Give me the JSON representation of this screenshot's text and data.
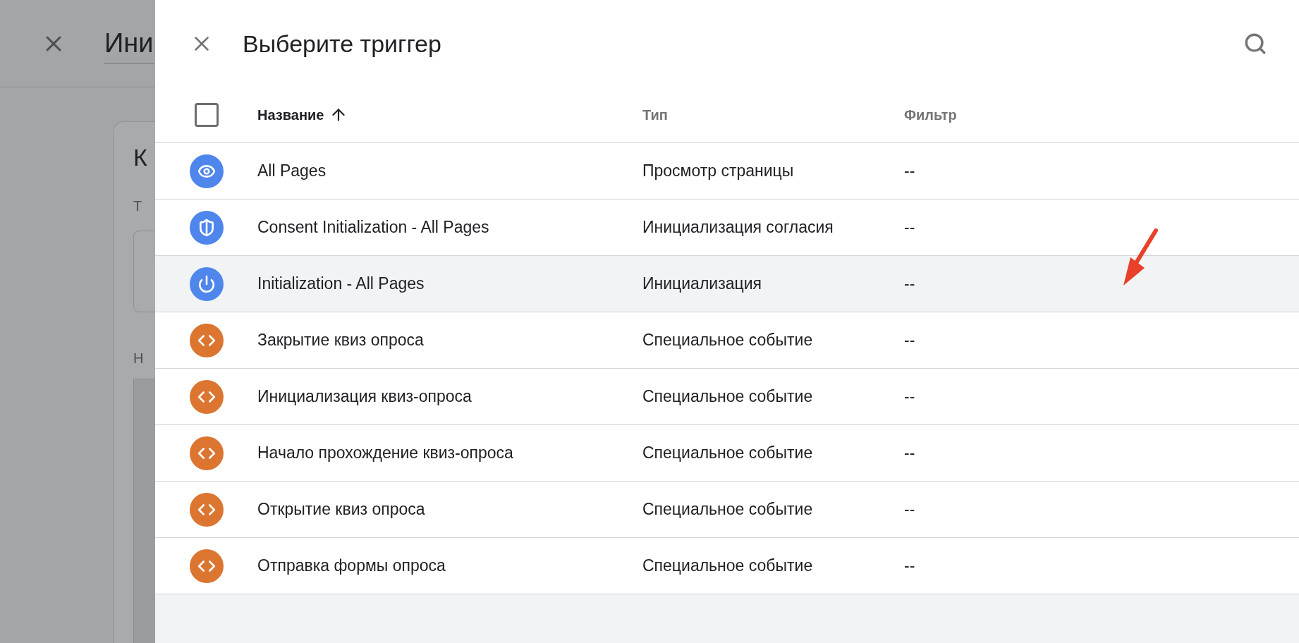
{
  "background_page": {
    "title": "Ини",
    "card_title": "К",
    "field_label": "Т",
    "section_label": "Н"
  },
  "panel": {
    "title": "Выберите триггер"
  },
  "table": {
    "select_all_checked": false,
    "columns": [
      {
        "label": "Название",
        "sorted": true
      },
      {
        "label": "Тип",
        "sorted": false
      },
      {
        "label": "Фильтр",
        "sorted": false
      }
    ],
    "rows": [
      {
        "kind": "page_view",
        "name": "All Pages",
        "type": "Просмотр страницы",
        "filter": "--",
        "selected": false
      },
      {
        "kind": "consent",
        "name": "Consent Initialization - All Pages",
        "type": "Инициализация согласия",
        "filter": "--",
        "selected": false
      },
      {
        "kind": "init",
        "name": "Initialization - All Pages",
        "type": "Инициализация",
        "filter": "--",
        "selected": true
      },
      {
        "kind": "custom_event",
        "name": "Закрытие квиз опроса",
        "type": "Специальное событие",
        "filter": "--",
        "selected": false
      },
      {
        "kind": "custom_event",
        "name": "Инициализация квиз-опроса",
        "type": "Специальное событие",
        "filter": "--",
        "selected": false
      },
      {
        "kind": "custom_event",
        "name": "Начало прохождение квиз-опроса",
        "type": "Специальное событие",
        "filter": "--",
        "selected": false
      },
      {
        "kind": "custom_event",
        "name": "Открытие квиз опроса",
        "type": "Специальное событие",
        "filter": "--",
        "selected": false
      },
      {
        "kind": "custom_event",
        "name": "Отправка формы опроса",
        "type": "Специальное событие",
        "filter": "--",
        "selected": false
      }
    ]
  }
}
